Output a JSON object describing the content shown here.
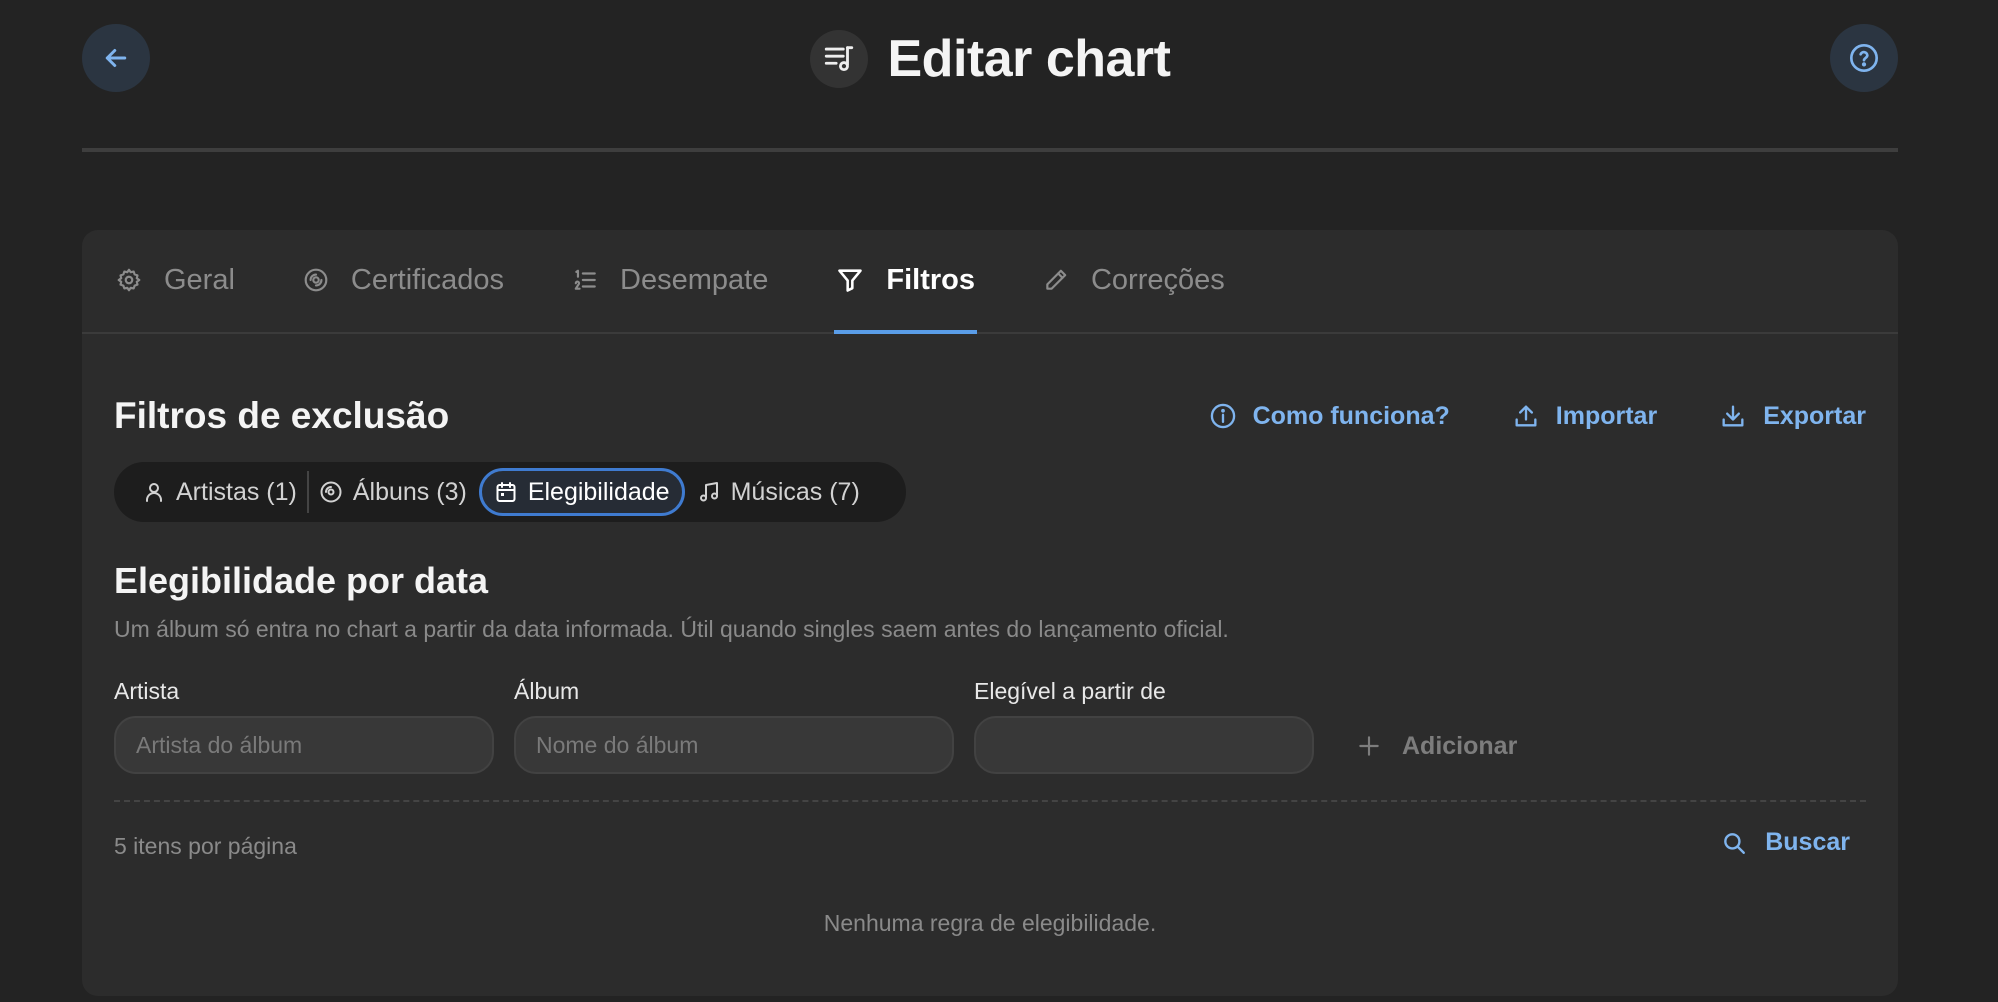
{
  "header": {
    "title": "Editar chart",
    "back_icon": "arrow-left-icon",
    "help_icon": "question-circle-icon",
    "title_icon": "music-list-icon"
  },
  "tabs": [
    {
      "label": "Geral",
      "icon": "gear-icon",
      "active": false
    },
    {
      "label": "Certificados",
      "icon": "disc-icon",
      "active": false
    },
    {
      "label": "Desempate",
      "icon": "ordered-list-icon",
      "active": false
    },
    {
      "label": "Filtros",
      "icon": "filter-icon",
      "active": true
    },
    {
      "label": "Correções",
      "icon": "pencil-icon",
      "active": false
    }
  ],
  "section": {
    "title": "Filtros de exclusão",
    "actions": {
      "how": "Como funciona?",
      "import": "Importar",
      "export": "Exportar"
    }
  },
  "segments": [
    {
      "label": "Artistas (1)",
      "icon": "user-icon",
      "active": false
    },
    {
      "label": "Álbuns (3)",
      "icon": "disc-icon",
      "active": false
    },
    {
      "label": "Elegibilidade",
      "icon": "calendar-icon",
      "active": true
    },
    {
      "label": "Músicas (7)",
      "icon": "music-note-icon",
      "active": false
    }
  ],
  "eligibility": {
    "title": "Elegibilidade por data",
    "description": "Um álbum só entra no chart a partir da data informada. Útil quando singles saem antes do lançamento oficial.",
    "fields": {
      "artist_label": "Artista",
      "artist_placeholder": "Artista do álbum",
      "artist_value": "",
      "album_label": "Álbum",
      "album_placeholder": "Nome do álbum",
      "album_value": "",
      "date_label": "Elegível a partir de",
      "date_value": ""
    },
    "add_label": "Adicionar",
    "per_page": "5 itens por página",
    "search_label": "Buscar",
    "empty_message": "Nenhuma regra de elegibilidade."
  },
  "colors": {
    "accent": "#5a9de8",
    "link": "#7fb4ee",
    "background": "#232323",
    "card": "#2c2c2c"
  }
}
